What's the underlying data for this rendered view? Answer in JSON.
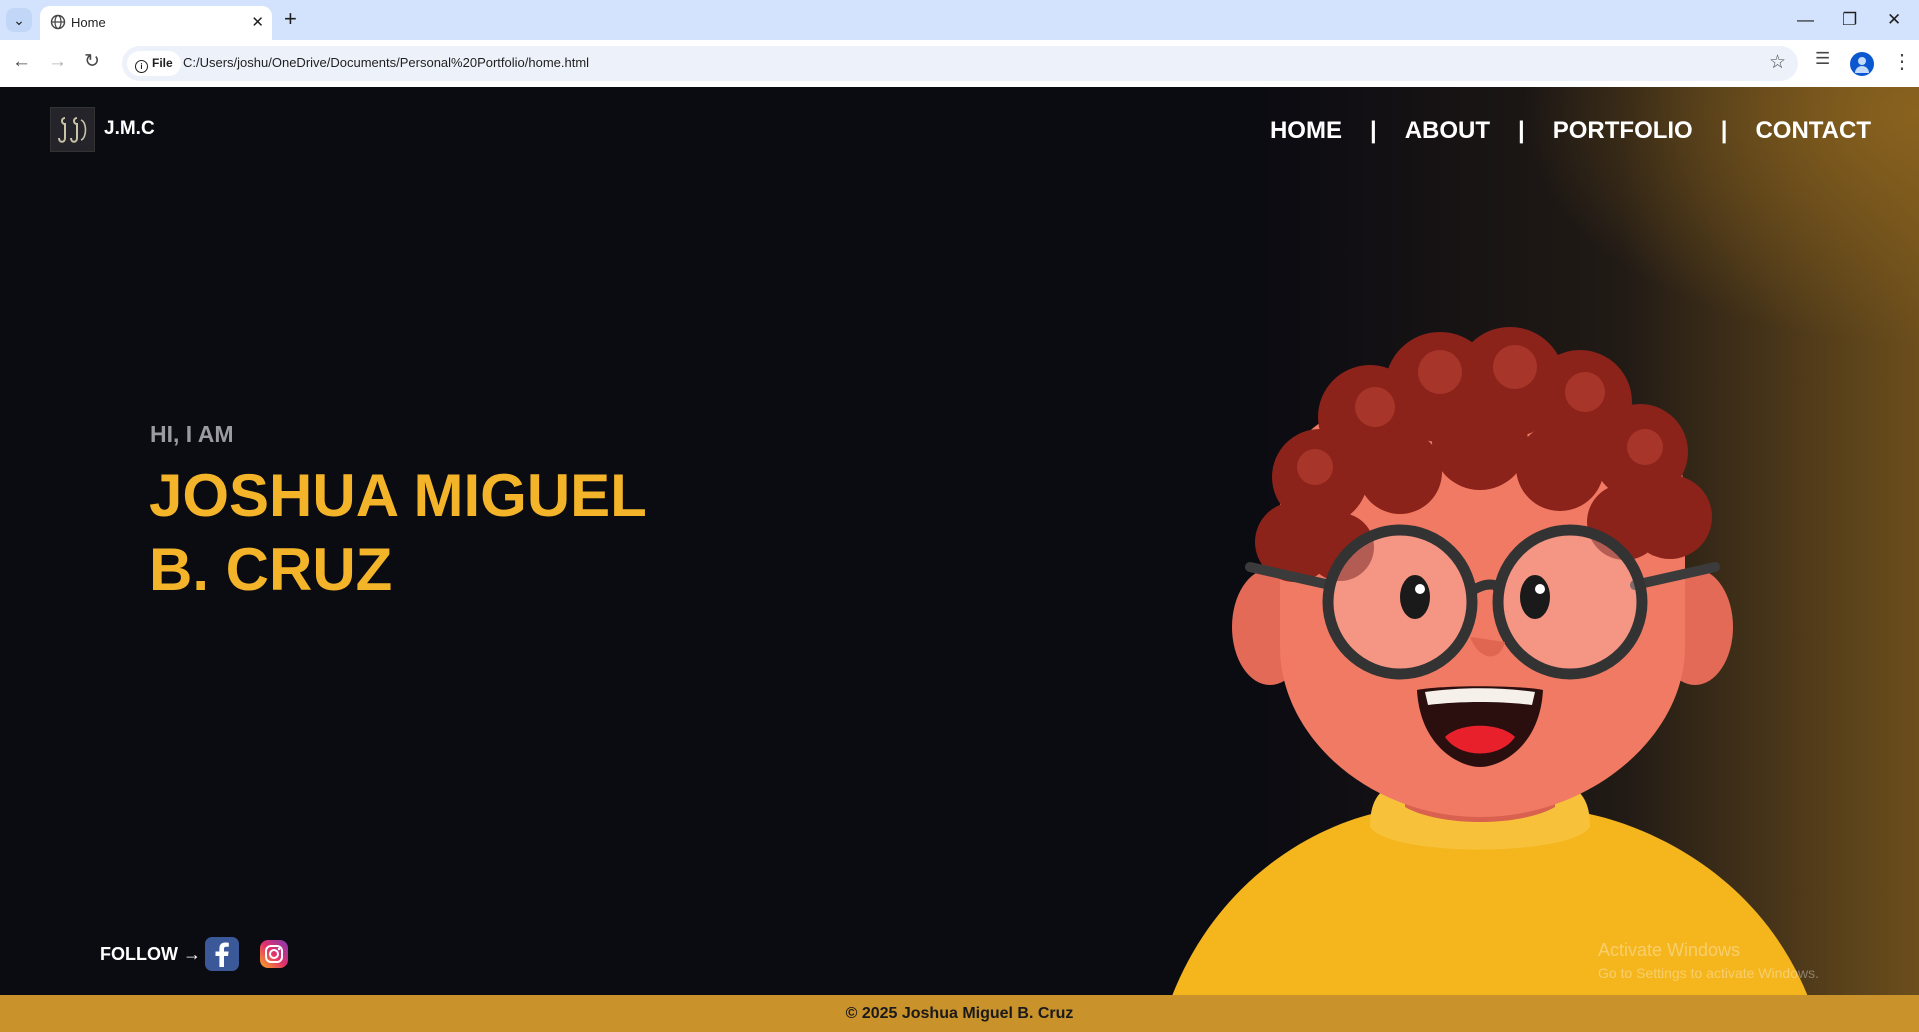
{
  "browser": {
    "tab_title": "Home",
    "url_chip": "File",
    "url": "C:/Users/joshu/OneDrive/Documents/Personal%20Portfolio/home.html"
  },
  "site": {
    "brand": "J.M.C",
    "nav": [
      "HOME",
      "ABOUT",
      "PORTFOLIO",
      "CONTACT"
    ],
    "nav_separator": "|",
    "greeting": "HI, I AM",
    "name_line1": "JOSHUA MIGUEL",
    "name_line2": "B. CRUZ",
    "follow_label": "FOLLOW →",
    "footer": "© 2025 Joshua Miguel B. Cruz"
  },
  "os_watermark": {
    "title": "Activate Windows",
    "subtitle": "Go to Settings to activate Windows."
  },
  "colors": {
    "background": "#0b0b12",
    "accent": "#f3b429",
    "footer": "#c9922a",
    "chrome_tabstrip": "#d3e3fd"
  },
  "icons": [
    "globe-icon",
    "facebook-icon",
    "instagram-icon",
    "star-icon",
    "profile-icon"
  ]
}
